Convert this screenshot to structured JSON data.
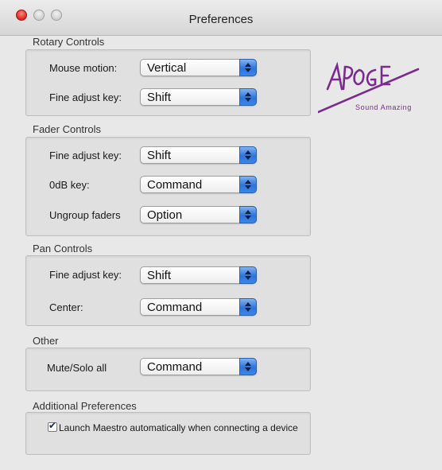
{
  "window": {
    "title": "Preferences"
  },
  "rotary": {
    "title": "Rotary Controls",
    "mouse_motion_label": "Mouse motion:",
    "mouse_motion_value": "Vertical",
    "fine_adjust_label": "Fine adjust key:",
    "fine_adjust_value": "Shift"
  },
  "fader": {
    "title": "Fader Controls",
    "fine_adjust_label": "Fine adjust key:",
    "fine_adjust_value": "Shift",
    "odb_label": "0dB key:",
    "odb_value": "Command",
    "ungroup_label": "Ungroup faders",
    "ungroup_value": "Option"
  },
  "pan": {
    "title": "Pan Controls",
    "fine_adjust_label": "Fine adjust key:",
    "fine_adjust_value": "Shift",
    "center_label": "Center:",
    "center_value": "Command"
  },
  "other": {
    "title": "Other",
    "mute_solo_label": "Mute/Solo all",
    "mute_solo_value": "Command"
  },
  "additional": {
    "title": "Additional Preferences",
    "launch_label": "Launch Maestro automatically when connecting a device",
    "launch_checked": true
  },
  "logo": {
    "brand": "Apogee",
    "tagline": "Sound Amazing",
    "color": "#7b2a8f"
  }
}
